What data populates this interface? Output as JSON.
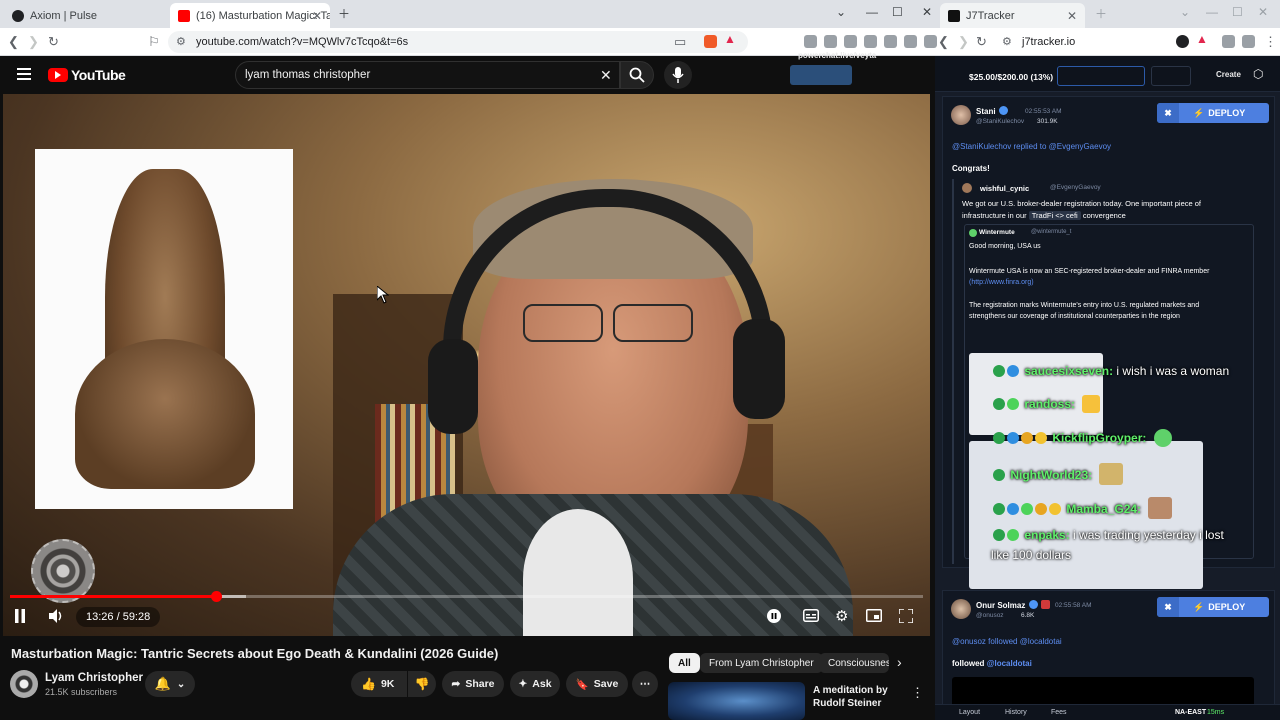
{
  "tabs": [
    {
      "label": "Axiom | Pulse"
    },
    {
      "label": "(16) Masturbation Magic: Tant"
    },
    {
      "label": "J7Tracker"
    }
  ],
  "address": {
    "left_url": "youtube.com/watch?v=MQWlv7cTcqo&t=6s",
    "right_url": "j7tracker.io"
  },
  "youtube": {
    "logo_text": "YouTube",
    "search_value": "lyam thomas christopher",
    "time": "13:26 / 59:28",
    "progress_fraction": 0.226,
    "title": "Masturbation Magic: Tantric Secrets about Ego Death & Kundalini (2026 Guide)",
    "channel": "Lyam Christopher",
    "subscribers": "21.5K subscribers",
    "like_count": "9K",
    "share_label": "Share",
    "ask_label": "Ask",
    "save_label": "Save",
    "chips": [
      "All",
      "From Lyam Christopher",
      "Consciousnes"
    ],
    "rec_title_1": "A meditation by",
    "rec_title_2": "Rudolf Steiner"
  },
  "tracker": {
    "stream_url": "powerchat.live/veyta",
    "budget": "$25.00/$200.00 (13%)",
    "create_label": "Create",
    "post1": {
      "name": "Stani",
      "time": "02:55:53 AM",
      "handle": "@StaniKulechov",
      "followers": "301.9K",
      "reply_user": "@StaniKulechov",
      "reply_text": "replied to",
      "reply_target": "@EvgenyGaevoy",
      "body": "Congrats!",
      "quote_name": "wishful_cynic",
      "quote_handle": "@EvgenyGaevoy",
      "quote_line1": "We got our U.S. broker-dealer registration today. One important piece of",
      "quote_line2": "infrastructure in our",
      "quote_tag": "TradFi <> cefi",
      "quote_line2b": "convergence",
      "inner_name": "Wintermute",
      "inner_handle": "@wintermute_t",
      "inner_l1": "Good morning, USA us",
      "inner_l2": "Wintermute USA is now an SEC-registered broker-dealer and FINRA member",
      "inner_l3": "(http://www.finra.org)",
      "inner_l4": "The registration marks Wintermute's entry into U.S. regulated markets and",
      "inner_l5": "strengthens our coverage of institutional counterparties in the region"
    },
    "post2": {
      "name": "Onur Solmaz",
      "time": "02:55:58 AM",
      "handle": "@onusoz",
      "followers": "6.8K",
      "follow_user": "@onusoz",
      "follow_text": "followed",
      "follow_target": "@localdotai",
      "body_label": "followed",
      "body_target": "@localdotai"
    },
    "deploy_label": "DEPLOY",
    "footer": [
      "Layout",
      "History",
      "Fees"
    ],
    "region": "NA-EAST",
    "region_ms": "15ms"
  },
  "chat": [
    {
      "user": "saucesixseven:",
      "msg": "i wish i was a woman"
    },
    {
      "user": "randoss:",
      "msg": ""
    },
    {
      "user": "KickflipGroyper:",
      "msg": ""
    },
    {
      "user": "NightWorld23:",
      "msg": ""
    },
    {
      "user": "Mamba_G24:",
      "msg": ""
    },
    {
      "user": "enpaks:",
      "msg": "i was trading yesterday i lost"
    },
    {
      "user": "",
      "msg": "like 100 dollars"
    }
  ],
  "colors": {
    "yt_red": "#ff0000",
    "deploy_blue": "#4d7fe0",
    "chat_green": "#5ff06a"
  }
}
